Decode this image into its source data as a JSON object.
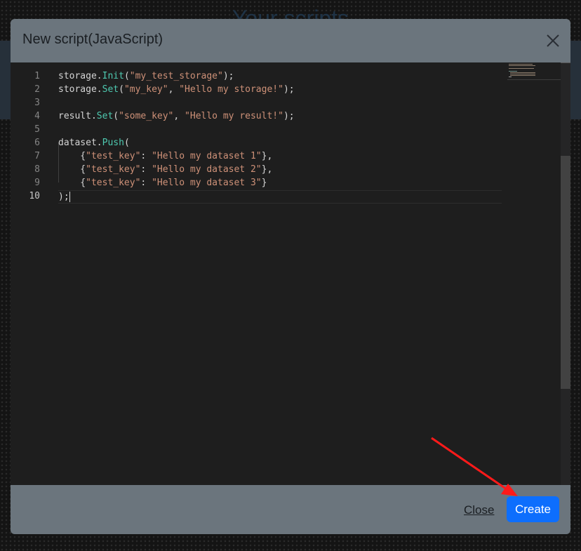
{
  "background": {
    "title": "Your scripts"
  },
  "modal": {
    "title": "New script(JavaScript)",
    "close_label": "Close",
    "create_label": "Create"
  },
  "editor": {
    "active_line": 10,
    "lines": [
      {
        "number": "1",
        "tokens": [
          {
            "t": "storage.",
            "c": "plain"
          },
          {
            "t": "Init",
            "c": "fn"
          },
          {
            "t": "(",
            "c": "plain"
          },
          {
            "t": "\"my_test_storage\"",
            "c": "str"
          },
          {
            "t": ");",
            "c": "plain"
          }
        ]
      },
      {
        "number": "2",
        "tokens": [
          {
            "t": "storage.",
            "c": "plain"
          },
          {
            "t": "Set",
            "c": "fn"
          },
          {
            "t": "(",
            "c": "plain"
          },
          {
            "t": "\"my_key\"",
            "c": "str"
          },
          {
            "t": ", ",
            "c": "plain"
          },
          {
            "t": "\"Hello my storage!\"",
            "c": "str"
          },
          {
            "t": ");",
            "c": "plain"
          }
        ]
      },
      {
        "number": "3",
        "tokens": []
      },
      {
        "number": "4",
        "tokens": [
          {
            "t": "result.",
            "c": "plain"
          },
          {
            "t": "Set",
            "c": "fn"
          },
          {
            "t": "(",
            "c": "plain"
          },
          {
            "t": "\"some_key\"",
            "c": "str"
          },
          {
            "t": ", ",
            "c": "plain"
          },
          {
            "t": "\"Hello my result!\"",
            "c": "str"
          },
          {
            "t": ");",
            "c": "plain"
          }
        ]
      },
      {
        "number": "5",
        "tokens": []
      },
      {
        "number": "6",
        "tokens": [
          {
            "t": "dataset.",
            "c": "plain"
          },
          {
            "t": "Push",
            "c": "fn"
          },
          {
            "t": "(",
            "c": "plain"
          }
        ]
      },
      {
        "number": "7",
        "tokens": [
          {
            "t": "    {",
            "c": "plain"
          },
          {
            "t": "\"test_key\"",
            "c": "str"
          },
          {
            "t": ": ",
            "c": "plain"
          },
          {
            "t": "\"Hello my dataset 1\"",
            "c": "str"
          },
          {
            "t": "},",
            "c": "plain"
          }
        ]
      },
      {
        "number": "8",
        "tokens": [
          {
            "t": "    {",
            "c": "plain"
          },
          {
            "t": "\"test_key\"",
            "c": "str"
          },
          {
            "t": ": ",
            "c": "plain"
          },
          {
            "t": "\"Hello my dataset 2\"",
            "c": "str"
          },
          {
            "t": "},",
            "c": "plain"
          }
        ]
      },
      {
        "number": "9",
        "tokens": [
          {
            "t": "    {",
            "c": "plain"
          },
          {
            "t": "\"test_key\"",
            "c": "str"
          },
          {
            "t": ": ",
            "c": "plain"
          },
          {
            "t": "\"Hello my dataset 3\"",
            "c": "str"
          },
          {
            "t": "}",
            "c": "plain"
          }
        ]
      },
      {
        "number": "10",
        "tokens": [
          {
            "t": ");",
            "c": "plain"
          }
        ]
      }
    ]
  },
  "colors": {
    "create_button": "#0d6efd",
    "annotation_arrow": "#ff1a1a",
    "function_token": "#4ec9b0",
    "string_token": "#ce9178"
  },
  "icons": {
    "close": "close-x-icon"
  }
}
